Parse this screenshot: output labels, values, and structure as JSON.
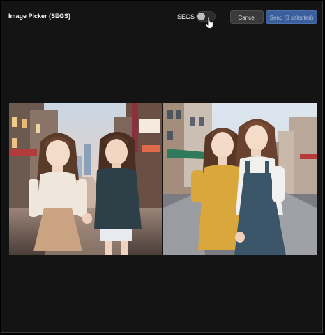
{
  "header": {
    "title": "Image Picker (SEGS)",
    "segs_label": "SEGS",
    "segs_toggle_on": false
  },
  "buttons": {
    "cancel_label": "Cancel",
    "send_label": "Send (0 selected)"
  },
  "images": [
    {
      "icon": "anime-girls-city-street-image-1"
    },
    {
      "icon": "anime-girls-city-street-image-2"
    }
  ],
  "colors": {
    "background": "#141414",
    "send_button": "#3a5f9c",
    "cancel_button": "#3a3a3a"
  }
}
